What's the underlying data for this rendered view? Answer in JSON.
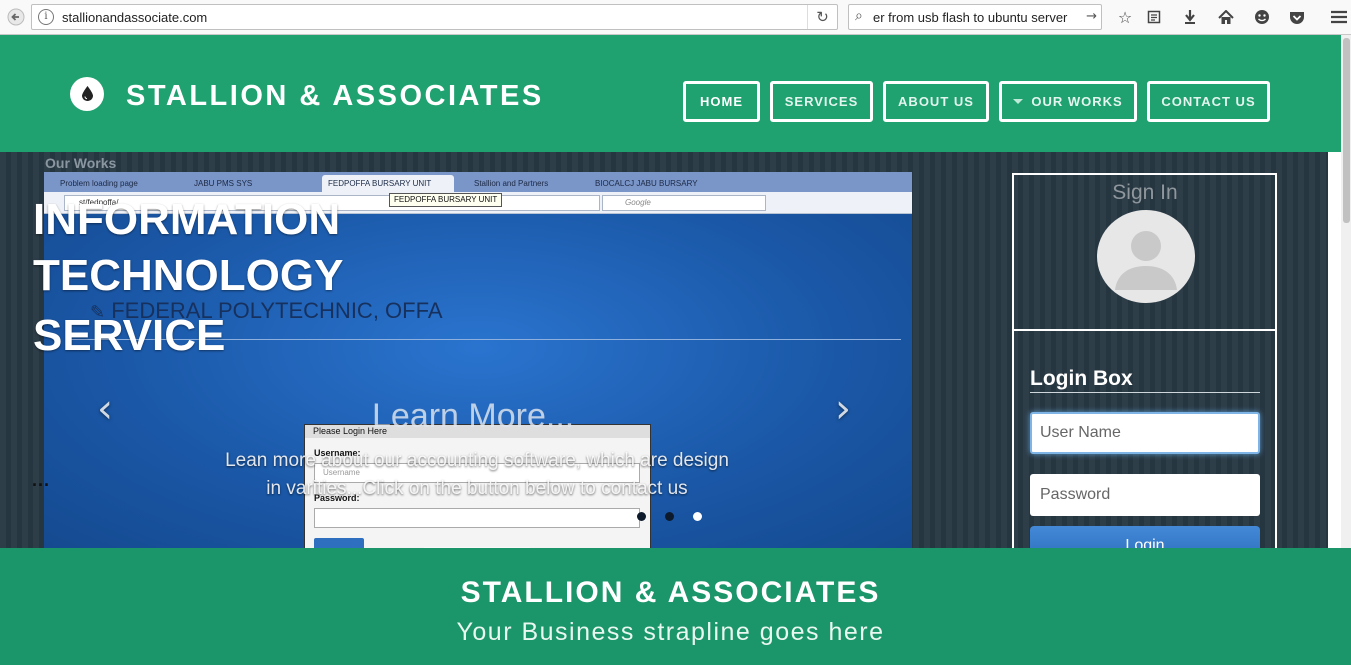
{
  "browser": {
    "url": "stallionandassociate.com",
    "search_query": "er from usb flash to ubuntu server",
    "icons": [
      "back-icon",
      "info-icon",
      "reload-icon",
      "search-icon",
      "go-arrow-icon",
      "bookmark-star-icon",
      "reading-list-icon",
      "download-icon",
      "home-icon",
      "hello-icon",
      "pocket-icon",
      "menu-icon"
    ]
  },
  "header": {
    "brand": "STALLION & ASSOCIATES",
    "nav": {
      "home": "HOME",
      "services": "SERVICES",
      "about": "ABOUT US",
      "works": "OUR WORKS",
      "contact": "CONTACT US"
    }
  },
  "hero": {
    "our_works_label": "Our Works",
    "title_lines": [
      "INFORMATION",
      "TECHNOLOGY",
      "SERVICE"
    ],
    "learn_title": "Learn More...",
    "learn_text": "Lean more about our accounting software, which are design in varities...Click on the button below to contact us",
    "ellipsis": "...",
    "prev_glyph": "‹",
    "next_glyph": "›",
    "indicators": 3,
    "active_indicator": 2,
    "screenshot": {
      "tabs": [
        "Problem loading page",
        "JABU PMS SYS",
        "FEDPOFFA BURSARY UNIT",
        "Stallion and Partners",
        "BIOCALCJ JABU BURSARY"
      ],
      "tooltip": "FEDPOFFA BURSARY UNIT",
      "url_fragment": "st/fedpoffa/",
      "google_placeholder": "Google",
      "heading": "FEDERAL POLYTECHNIC, OFFA",
      "login_title": "Please Login Here",
      "username_label": "Username:",
      "username_placeholder": "Username",
      "password_label": "Password:"
    }
  },
  "sidebar": {
    "signin_title": "Sign In",
    "login_box_title": "Login Box",
    "username_placeholder": "User Name",
    "password_placeholder": "Password",
    "login_button": "Login"
  },
  "band": {
    "title": "STALLION & ASSOCIATES",
    "strapline": "Your Business strapline goes here"
  },
  "colors": {
    "brand_green": "#1fa170",
    "band_green": "#1b956a",
    "hero_dark": "#2b3a45",
    "login_blue": "#2a6cb8"
  }
}
